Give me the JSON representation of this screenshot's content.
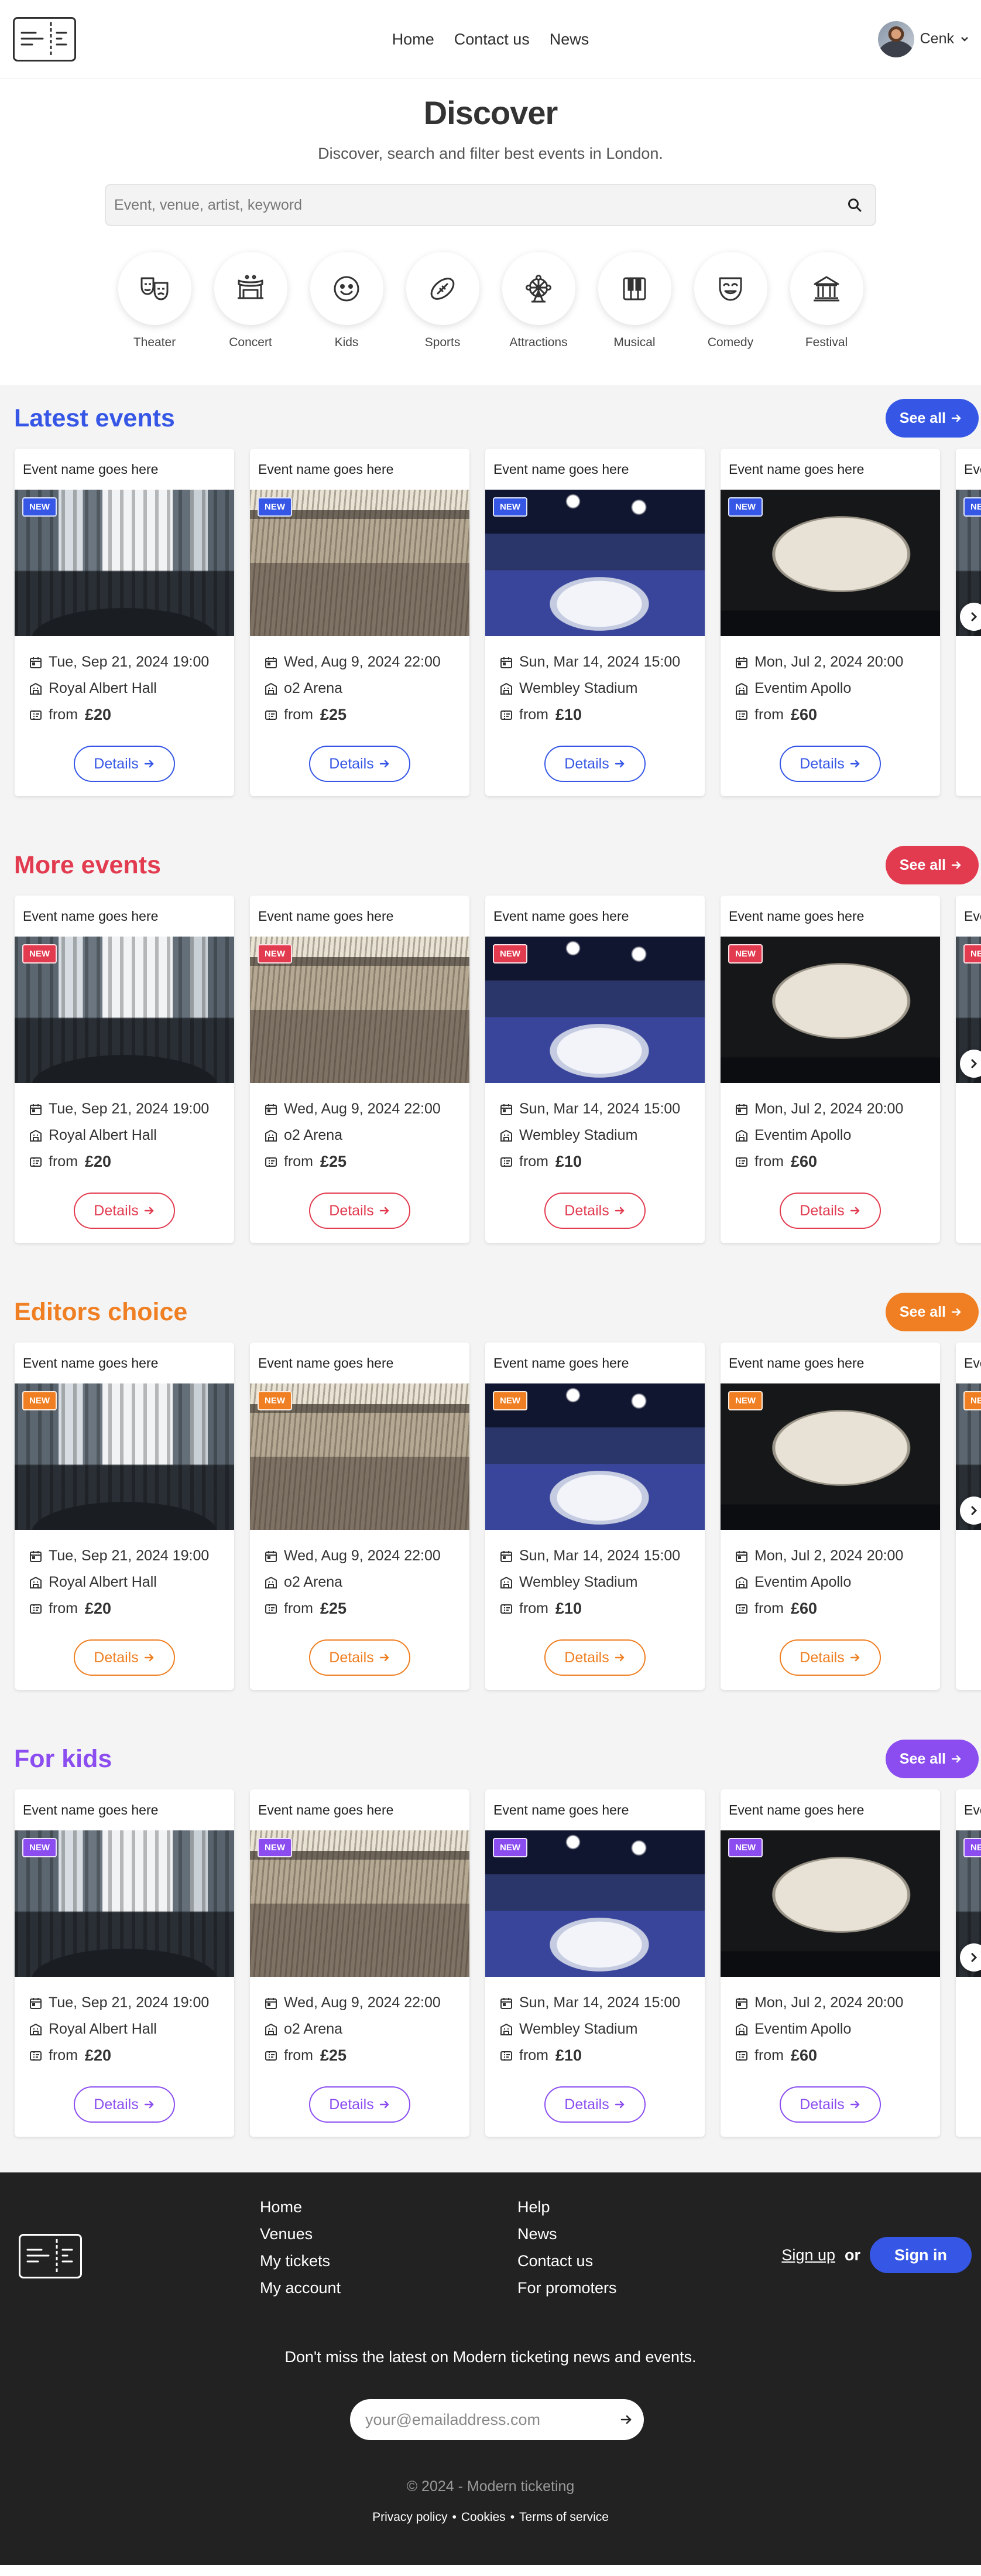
{
  "header": {
    "logo_icon": "ticket-logo-icon",
    "nav": [
      "Home",
      "Contact us",
      "News"
    ],
    "user_name": "Cenk",
    "user_menu_icon": "chevron-down-icon"
  },
  "discover": {
    "title": "Discover",
    "subtitle": "Discover, search and filter best events in London.",
    "search_placeholder": "Event, venue, artist, keyword",
    "search_icon": "search-icon"
  },
  "categories": [
    {
      "label": "Theater",
      "icon": "theater-masks-icon"
    },
    {
      "label": "Concert",
      "icon": "concert-stage-icon"
    },
    {
      "label": "Kids",
      "icon": "smiley-face-icon"
    },
    {
      "label": "Sports",
      "icon": "football-icon"
    },
    {
      "label": "Attractions",
      "icon": "ferris-wheel-icon"
    },
    {
      "label": "Musical",
      "icon": "piano-keys-icon"
    },
    {
      "label": "Comedy",
      "icon": "comedy-mask-icon"
    },
    {
      "label": "Festival",
      "icon": "museum-building-icon"
    }
  ],
  "events": [
    {
      "name": "Event name goes here",
      "badge": "NEW",
      "date": "Tue, Sep 21, 2024 19:00",
      "venue": "Royal Albert Hall",
      "price_prefix": "from",
      "price": "£20",
      "details_label": "Details"
    },
    {
      "name": "Event name goes here",
      "badge": "NEW",
      "date": "Wed, Aug 9, 2024 22:00",
      "venue": "o2 Arena",
      "price_prefix": "from",
      "price": "£25",
      "details_label": "Details"
    },
    {
      "name": "Event name goes here",
      "badge": "NEW",
      "date": "Sun, Mar 14, 2024 15:00",
      "venue": "Wembley Stadium",
      "price_prefix": "from",
      "price": "£10",
      "details_label": "Details"
    },
    {
      "name": "Event name goes here",
      "badge": "NEW",
      "date": "Mon, Jul 2, 2024 20:00",
      "venue": "Eventim Apollo",
      "price_prefix": "from",
      "price": "£60",
      "details_label": "Details"
    },
    {
      "name": "Event name goes here",
      "badge": "NEW",
      "date": "",
      "venue": "",
      "price_prefix": "",
      "price": "",
      "details_label": ""
    }
  ],
  "sections": [
    {
      "title": "Latest events",
      "see_all": "See all",
      "color": "#3657e6"
    },
    {
      "title": "More events",
      "see_all": "See all",
      "color": "#e23b4f"
    },
    {
      "title": "Editors choice",
      "see_all": "See all",
      "color": "#ef7f22"
    },
    {
      "title": "For kids",
      "see_all": "See all",
      "color": "#8b4df0"
    }
  ],
  "footer": {
    "col1": [
      "Home",
      "Venues",
      "My tickets",
      "My account"
    ],
    "col2": [
      "Help",
      "News",
      "Contact us",
      "For promoters"
    ],
    "signup": "Sign up",
    "or": "or",
    "signin": "Sign in",
    "newsletter": "Don't miss the latest on Modern ticketing news and events.",
    "email_placeholder": "your@emailaddress.com",
    "copyright": "© 2024 - Modern ticketing",
    "legal": [
      "Privacy policy",
      "Cookies",
      "Terms of service"
    ]
  }
}
